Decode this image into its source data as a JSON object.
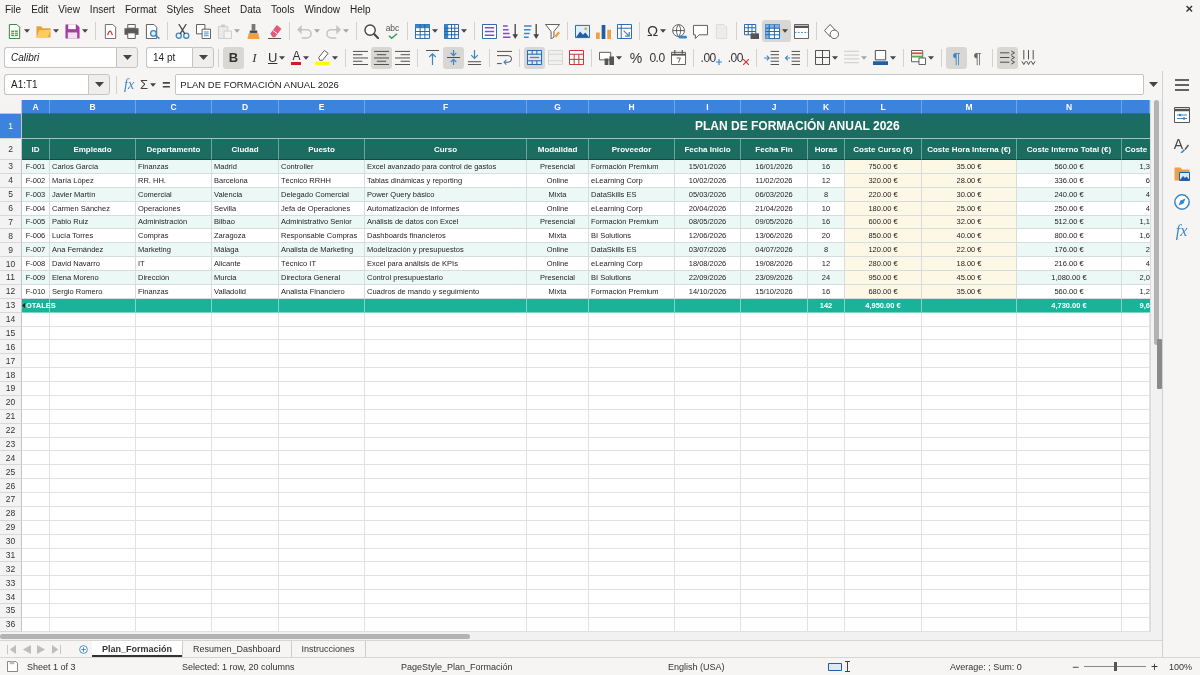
{
  "menu": [
    "File",
    "Edit",
    "View",
    "Insert",
    "Format",
    "Styles",
    "Sheet",
    "Data",
    "Tools",
    "Window",
    "Help"
  ],
  "close_button": "×",
  "standard_toolbar": [
    [
      {
        "kind": "new",
        "dropdown": true,
        "disabled": false,
        "on": false
      },
      {
        "kind": "open",
        "dropdown": true,
        "disabled": false,
        "on": false
      },
      {
        "kind": "save",
        "dropdown": true,
        "disabled": false,
        "on": false
      }
    ],
    [
      {
        "kind": "export_pdf",
        "dropdown": false,
        "disabled": false,
        "on": false
      },
      {
        "kind": "print",
        "dropdown": false,
        "disabled": false,
        "on": false
      },
      {
        "kind": "print_preview",
        "dropdown": false,
        "disabled": false,
        "on": false
      }
    ],
    [
      {
        "kind": "cut",
        "dropdown": false,
        "disabled": false,
        "on": false
      },
      {
        "kind": "copy",
        "dropdown": false,
        "disabled": false,
        "on": false
      },
      {
        "kind": "paste",
        "dropdown": true,
        "disabled": true,
        "on": false
      },
      {
        "kind": "clone_formatting",
        "dropdown": false,
        "disabled": false,
        "on": false
      },
      {
        "kind": "clear_formatting",
        "dropdown": false,
        "disabled": false,
        "on": false
      }
    ],
    [
      {
        "kind": "undo",
        "dropdown": true,
        "disabled": true,
        "on": false
      },
      {
        "kind": "redo",
        "dropdown": true,
        "disabled": true,
        "on": false
      }
    ],
    [
      {
        "kind": "find_replace",
        "dropdown": false,
        "disabled": false,
        "on": false
      },
      {
        "kind": "spelling",
        "glyph": "abc",
        "dropdown": false,
        "disabled": false,
        "on": false
      }
    ],
    [
      {
        "kind": "rows",
        "dropdown": true,
        "disabled": false,
        "on": false
      },
      {
        "kind": "columns",
        "dropdown": true,
        "disabled": false,
        "on": false
      }
    ],
    [
      {
        "kind": "sort",
        "dropdown": false,
        "disabled": false,
        "on": false
      },
      {
        "kind": "sort_ascending",
        "dropdown": false,
        "disabled": false,
        "on": false
      },
      {
        "kind": "sort_descending",
        "dropdown": false,
        "disabled": false,
        "on": false
      },
      {
        "kind": "autofilter",
        "dropdown": false,
        "disabled": false,
        "on": false
      }
    ],
    [
      {
        "kind": "image",
        "dropdown": false,
        "disabled": false,
        "on": false
      },
      {
        "kind": "chart",
        "dropdown": false,
        "disabled": false,
        "on": false
      },
      {
        "kind": "pivot_table",
        "dropdown": false,
        "disabled": false,
        "on": false
      }
    ],
    [
      {
        "kind": "special_character",
        "glyph": "Ω",
        "dropdown": true,
        "disabled": false,
        "on": false
      },
      {
        "kind": "hyperlink",
        "dropdown": false,
        "disabled": false,
        "on": false
      },
      {
        "kind": "comment",
        "dropdown": false,
        "disabled": false,
        "on": false
      },
      {
        "kind": "header_footer",
        "dropdown": false,
        "disabled": true,
        "on": false
      }
    ],
    [
      {
        "kind": "print_area",
        "dropdown": false,
        "disabled": false,
        "on": false
      },
      {
        "kind": "freeze",
        "dropdown": true,
        "disabled": false,
        "on": true
      },
      {
        "kind": "split_window",
        "dropdown": false,
        "disabled": false,
        "on": false
      }
    ],
    [
      {
        "kind": "draw_functions",
        "dropdown": false,
        "disabled": false,
        "on": false
      }
    ]
  ],
  "formatting_toolbar": {
    "font_name": "Calibri",
    "font_size": "14 pt",
    "groups": [
      [
        {
          "kind": "bold",
          "glyph": "B",
          "dropdown": false,
          "disabled": false,
          "on": true
        },
        {
          "kind": "italic",
          "glyph": "I",
          "dropdown": false,
          "disabled": false,
          "on": false
        },
        {
          "kind": "underline",
          "glyph": "U",
          "dropdown": true,
          "disabled": false,
          "on": false
        },
        {
          "kind": "font_color",
          "glyph": "A",
          "dropdown": true,
          "disabled": false,
          "on": false
        },
        {
          "kind": "highlight",
          "dropdown": true,
          "disabled": false,
          "on": false
        }
      ],
      [
        {
          "kind": "align_left",
          "dropdown": false,
          "disabled": false,
          "on": false
        },
        {
          "kind": "align_center",
          "dropdown": false,
          "disabled": false,
          "on": true
        },
        {
          "kind": "align_right",
          "dropdown": false,
          "disabled": false,
          "on": false
        }
      ],
      [
        {
          "kind": "align_top",
          "dropdown": false,
          "disabled": false,
          "on": false
        },
        {
          "kind": "align_middle",
          "dropdown": false,
          "disabled": false,
          "on": true
        },
        {
          "kind": "align_bottom",
          "dropdown": false,
          "disabled": false,
          "on": false
        }
      ],
      [
        {
          "kind": "wrap_text",
          "dropdown": false,
          "disabled": false,
          "on": false
        }
      ],
      [
        {
          "kind": "merge_center",
          "dropdown": false,
          "disabled": false,
          "on": true
        },
        {
          "kind": "merge_cells",
          "dropdown": false,
          "disabled": true,
          "on": false
        },
        {
          "kind": "unmerge_cells",
          "dropdown": false,
          "disabled": false,
          "on": false
        }
      ],
      [
        {
          "kind": "currency",
          "dropdown": true,
          "disabled": false,
          "on": false
        },
        {
          "kind": "percent",
          "glyph": "%",
          "dropdown": false,
          "disabled": false,
          "on": false
        },
        {
          "kind": "number",
          "glyph": "0.0",
          "dropdown": false,
          "disabled": false,
          "on": false
        },
        {
          "kind": "date",
          "dropdown": false,
          "disabled": false,
          "on": false
        }
      ],
      [
        {
          "kind": "add_decimal",
          "glyph": ".00",
          "dropdown": false,
          "disabled": false,
          "on": false
        },
        {
          "kind": "delete_decimal",
          "glyph": ".00",
          "dropdown": false,
          "disabled": false,
          "on": false
        }
      ],
      [
        {
          "kind": "indent_increase",
          "dropdown": false,
          "disabled": false,
          "on": false
        },
        {
          "kind": "indent_decrease",
          "dropdown": false,
          "disabled": false,
          "on": false
        }
      ],
      [
        {
          "kind": "borders",
          "dropdown": true,
          "disabled": false,
          "on": false
        },
        {
          "kind": "border_style",
          "dropdown": true,
          "disabled": true,
          "on": false
        },
        {
          "kind": "border_color",
          "dropdown": true,
          "disabled": false,
          "on": false
        }
      ],
      [
        {
          "kind": "conditional",
          "dropdown": true,
          "disabled": false,
          "on": false
        }
      ],
      [
        {
          "kind": "left_to_right",
          "glyph": "¶",
          "dropdown": false,
          "disabled": false,
          "on": true
        },
        {
          "kind": "right_to_left",
          "glyph": "¶",
          "dropdown": false,
          "disabled": false,
          "on": false
        }
      ],
      [
        {
          "kind": "text_horizontal",
          "dropdown": false,
          "disabled": false,
          "on": true
        },
        {
          "kind": "text_vertical",
          "dropdown": false,
          "disabled": false,
          "on": false
        }
      ]
    ]
  },
  "formula_bar": {
    "name_box": "A1:T1",
    "function_glyph": "fx",
    "sum_glyph": "Σ",
    "equals_glyph": "=",
    "content": "PLAN DE FORMACIÓN ANUAL 2026"
  },
  "sidebar": [
    {
      "kind": "properties"
    },
    {
      "kind": "styles",
      "glyph": "A"
    },
    {
      "kind": "gallery"
    },
    {
      "kind": "navigator"
    },
    {
      "kind": "functions",
      "glyph": "fx"
    }
  ],
  "sheet": {
    "columns": [
      {
        "letter": "A",
        "selected": true
      },
      {
        "letter": "B",
        "selected": true
      },
      {
        "letter": "C",
        "selected": true
      },
      {
        "letter": "D",
        "selected": true
      },
      {
        "letter": "E",
        "selected": true
      },
      {
        "letter": "F",
        "selected": true
      },
      {
        "letter": "G",
        "selected": true
      },
      {
        "letter": "H",
        "selected": true
      },
      {
        "letter": "I",
        "selected": true
      },
      {
        "letter": "J",
        "selected": true
      },
      {
        "letter": "K",
        "selected": true
      },
      {
        "letter": "L",
        "selected": true
      },
      {
        "letter": "M",
        "selected": true
      },
      {
        "letter": "N",
        "selected": true
      }
    ],
    "row_headers": [
      {
        "label": "1",
        "selected": true
      },
      {
        "label": "2",
        "selected": false
      },
      {
        "label": "3",
        "selected": false
      },
      {
        "label": "4",
        "selected": false
      },
      {
        "label": "5",
        "selected": false
      },
      {
        "label": "6",
        "selected": false
      },
      {
        "label": "7",
        "selected": false
      },
      {
        "label": "8",
        "selected": false
      },
      {
        "label": "9",
        "selected": false
      },
      {
        "label": "10",
        "selected": false
      },
      {
        "label": "11",
        "selected": false
      },
      {
        "label": "12",
        "selected": false
      },
      {
        "label": "13",
        "selected": false
      },
      {
        "label": "14",
        "selected": false
      },
      {
        "label": "15",
        "selected": false
      },
      {
        "label": "16",
        "selected": false
      },
      {
        "label": "17",
        "selected": false
      },
      {
        "label": "18",
        "selected": false
      },
      {
        "label": "19",
        "selected": false
      },
      {
        "label": "20",
        "selected": false
      },
      {
        "label": "21",
        "selected": false
      },
      {
        "label": "22",
        "selected": false
      },
      {
        "label": "23",
        "selected": false
      },
      {
        "label": "24",
        "selected": false
      },
      {
        "label": "25",
        "selected": false
      },
      {
        "label": "26",
        "selected": false
      },
      {
        "label": "27",
        "selected": false
      },
      {
        "label": "28",
        "selected": false
      },
      {
        "label": "29",
        "selected": false
      },
      {
        "label": "30",
        "selected": false
      },
      {
        "label": "31",
        "selected": false
      },
      {
        "label": "32",
        "selected": false
      },
      {
        "label": "33",
        "selected": false
      },
      {
        "label": "34",
        "selected": false
      },
      {
        "label": "35",
        "selected": false
      },
      {
        "label": "36",
        "selected": false
      }
    ],
    "title": "PLAN DE FORMACIÓN ANUAL 2026",
    "header": [
      "ID",
      "Empleado",
      "Departamento",
      "Ciudad",
      "Puesto",
      "Curso",
      "Modalidad",
      "Proveedor",
      "Fecha Inicio",
      "Fecha Fin",
      "Horas",
      "Coste Curso (€)",
      "Coste Hora Interna (€)",
      "Coste Interno Total (€)",
      "Coste"
    ],
    "rows": [
      [
        "F-001",
        "Carlos García",
        "Finanzas",
        "Madrid",
        "Controller",
        "Excel avanzado para control de gastos",
        "Presencial",
        "Formación Premium",
        "15/01/2026",
        "16/01/2026",
        "16",
        "750.00 €",
        "35.00 €",
        "560.00 €",
        "1,3"
      ],
      [
        "F-002",
        "María López",
        "RR. HH.",
        "Barcelona",
        "Técnico RRHH",
        "Tablas dinámicas y reporting",
        "Online",
        "eLearning Corp",
        "10/02/2026",
        "11/02/2026",
        "12",
        "320.00 €",
        "28.00 €",
        "336.00 €",
        "6"
      ],
      [
        "F-003",
        "Javier Martín",
        "Comercial",
        "Valencia",
        "Delegado Comercial",
        "Power Query básico",
        "Mixta",
        "DataSkills ES",
        "05/03/2026",
        "06/03/2026",
        "8",
        "220.00 €",
        "30.00 €",
        "240.00 €",
        "4"
      ],
      [
        "F-004",
        "Carmen Sánchez",
        "Operaciones",
        "Sevilla",
        "Jefa de Operaciones",
        "Automatización de informes",
        "Online",
        "eLearning Corp",
        "20/04/2026",
        "21/04/2026",
        "10",
        "180.00 €",
        "25.00 €",
        "250.00 €",
        "4"
      ],
      [
        "F-005",
        "Pablo Ruiz",
        "Administración",
        "Bilbao",
        "Administrativo Senior",
        "Análisis de datos con Excel",
        "Presencial",
        "Formación Premium",
        "08/05/2026",
        "09/05/2026",
        "16",
        "600.00 €",
        "32.00 €",
        "512.00 €",
        "1,1"
      ],
      [
        "F-006",
        "Lucía Torres",
        "Compras",
        "Zaragoza",
        "Responsable Compras",
        "Dashboards financieros",
        "Mixta",
        "BI Solutions",
        "12/06/2026",
        "13/06/2026",
        "20",
        "850.00 €",
        "40.00 €",
        "800.00 €",
        "1,6"
      ],
      [
        "F-007",
        "Ana Fernández",
        "Marketing",
        "Málaga",
        "Analista de Marketing",
        "Modelización y presupuestos",
        "Online",
        "DataSkills ES",
        "03/07/2026",
        "04/07/2026",
        "8",
        "120.00 €",
        "22.00 €",
        "176.00 €",
        "2"
      ],
      [
        "F-008",
        "David Navarro",
        "IT",
        "Alicante",
        "Técnico IT",
        "Excel para análisis de KPIs",
        "Online",
        "eLearning Corp",
        "18/08/2026",
        "19/08/2026",
        "12",
        "280.00 €",
        "18.00 €",
        "216.00 €",
        "4"
      ],
      [
        "F-009",
        "Elena Moreno",
        "Dirección",
        "Murcia",
        "Directora General",
        "Control presupuestario",
        "Presencial",
        "BI Solutions",
        "22/09/2026",
        "23/09/2026",
        "24",
        "950.00 €",
        "45.00 €",
        "1,080.00 €",
        "2,0"
      ],
      [
        "F-010",
        "Sergio Romero",
        "Finanzas",
        "Valladolid",
        "Analista Financiero",
        "Cuadros de mando y seguimiento",
        "Mixta",
        "Formación Premium",
        "14/10/2026",
        "15/10/2026",
        "16",
        "680.00 €",
        "35.00 €",
        "560.00 €",
        "1,2"
      ]
    ],
    "totals": {
      "label": "OTALES",
      "horas": "142",
      "coste_curso": "4,950.00 €",
      "coste_interno_total": "4,730.00 €",
      "column_15": "9,6"
    }
  },
  "sheet_nav": [
    {
      "kind": "first",
      "disabled": true
    },
    {
      "kind": "previous",
      "disabled": true
    },
    {
      "kind": "next",
      "disabled": true
    },
    {
      "kind": "last",
      "disabled": true
    }
  ],
  "sheet_tabs": [
    {
      "label": "Plan_Formación",
      "selected": true
    },
    {
      "label": "Resumen_Dashboard",
      "selected": false
    },
    {
      "label": "Instrucciones",
      "selected": false
    }
  ],
  "status_bar": {
    "sheet": "Sheet 1 of 3",
    "selection": "Selected: 1 row, 20 columns",
    "page_style": "PageStyle_Plan_Formación",
    "language": "English (USA)",
    "summary": "Average: ; Sum: 0",
    "zoom_out": "−",
    "zoom_in": "+",
    "zoom_slider": {
      "level": 0.5
    },
    "zoom": "100%"
  }
}
